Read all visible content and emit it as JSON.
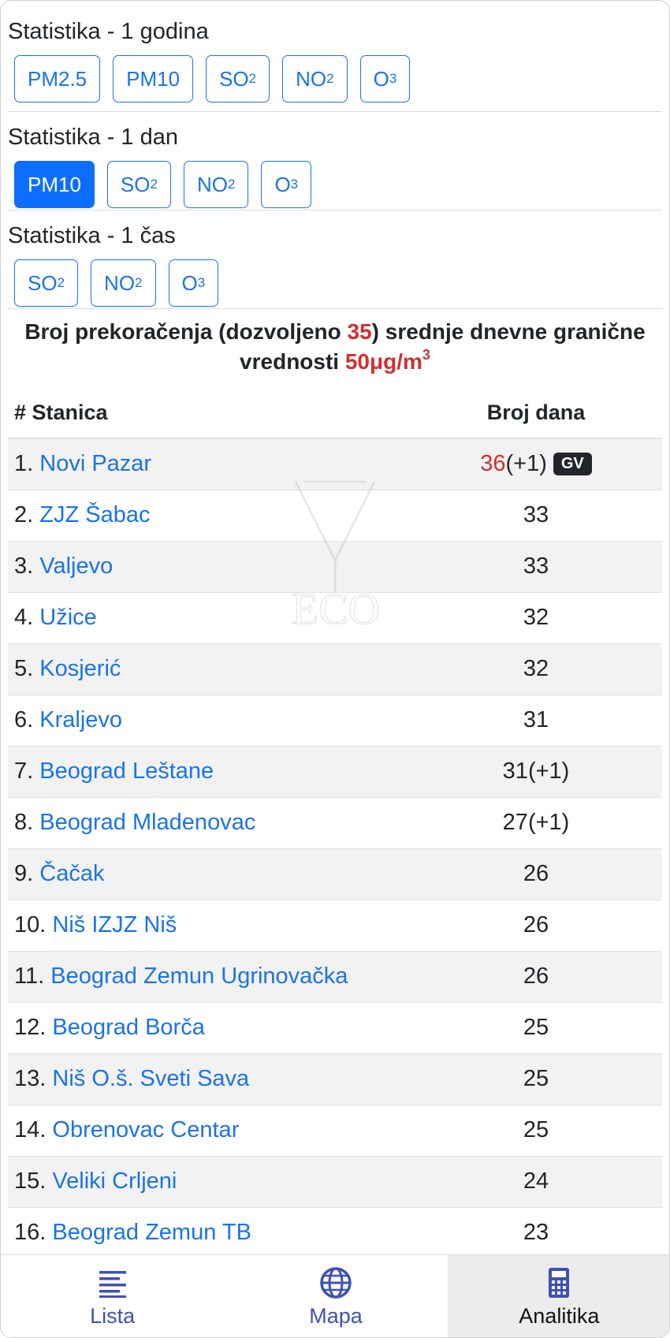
{
  "sections": [
    {
      "title": "Statistika - 1 godina",
      "buttons": [
        {
          "main": "PM2.5",
          "sub": ""
        },
        {
          "main": "PM10",
          "sub": ""
        },
        {
          "main": "SO",
          "sub": "2"
        },
        {
          "main": "NO",
          "sub": "2"
        },
        {
          "main": "O",
          "sub": "3"
        }
      ]
    },
    {
      "title": "Statistika - 1 dan",
      "buttons": [
        {
          "main": "PM10",
          "sub": "",
          "active": true
        },
        {
          "main": "SO",
          "sub": "2"
        },
        {
          "main": "NO",
          "sub": "2"
        },
        {
          "main": "O",
          "sub": "3"
        }
      ]
    },
    {
      "title": "Statistika - 1 čas",
      "buttons": [
        {
          "main": "SO",
          "sub": "2"
        },
        {
          "main": "NO",
          "sub": "2"
        },
        {
          "main": "O",
          "sub": "3"
        }
      ]
    }
  ],
  "heading": {
    "part1": "Broj prekoračenja (dozvoljeno ",
    "allowed": "35",
    "part2": ") srednje dnevne granične vrednosti ",
    "limit": "50μg/m",
    "limit_sup": "3"
  },
  "table": {
    "col_station": "# Stanica",
    "col_days": "Broj dana",
    "rows": [
      {
        "num": "1.",
        "name": "Novi Pazar",
        "days": "36",
        "extra": "(+1)",
        "badge": "GV",
        "days_red": true
      },
      {
        "num": "2.",
        "name": "ZJZ Šabac",
        "days": "33",
        "extra": ""
      },
      {
        "num": "3.",
        "name": "Valjevo",
        "days": "33",
        "extra": ""
      },
      {
        "num": "4.",
        "name": "Užice",
        "days": "32",
        "extra": ""
      },
      {
        "num": "5.",
        "name": "Kosjerić",
        "days": "32",
        "extra": ""
      },
      {
        "num": "6.",
        "name": "Kraljevo",
        "days": "31",
        "extra": ""
      },
      {
        "num": "7.",
        "name": "Beograd Leštane",
        "days": "31",
        "extra": "(+1)"
      },
      {
        "num": "8.",
        "name": "Beograd Mladenovac",
        "days": "27",
        "extra": "(+1)"
      },
      {
        "num": "9.",
        "name": "Čačak",
        "days": "26",
        "extra": ""
      },
      {
        "num": "10.",
        "name": "Niš IZJZ Niš",
        "days": "26",
        "extra": ""
      },
      {
        "num": "11.",
        "name": "Beograd Zemun Ugrinovačka",
        "days": "26",
        "extra": ""
      },
      {
        "num": "12.",
        "name": "Beograd Borča",
        "days": "25",
        "extra": ""
      },
      {
        "num": "13.",
        "name": "Niš O.š. Sveti Sava",
        "days": "25",
        "extra": ""
      },
      {
        "num": "14.",
        "name": "Obrenovac Centar",
        "days": "25",
        "extra": ""
      },
      {
        "num": "15.",
        "name": "Veliki Crljeni",
        "days": "24",
        "extra": ""
      },
      {
        "num": "16.",
        "name": "Beograd Zemun TB",
        "days": "23",
        "extra": ""
      }
    ]
  },
  "nav": [
    {
      "label": "Lista",
      "icon": "list-icon"
    },
    {
      "label": "Mapa",
      "icon": "globe-icon"
    },
    {
      "label": "Analitika",
      "icon": "calculator-icon",
      "active": true
    }
  ],
  "colors": {
    "link": "#1a73e8",
    "active_button": "#0d6efd",
    "highlight": "#d32f2f",
    "nav": "#3f51b5"
  }
}
